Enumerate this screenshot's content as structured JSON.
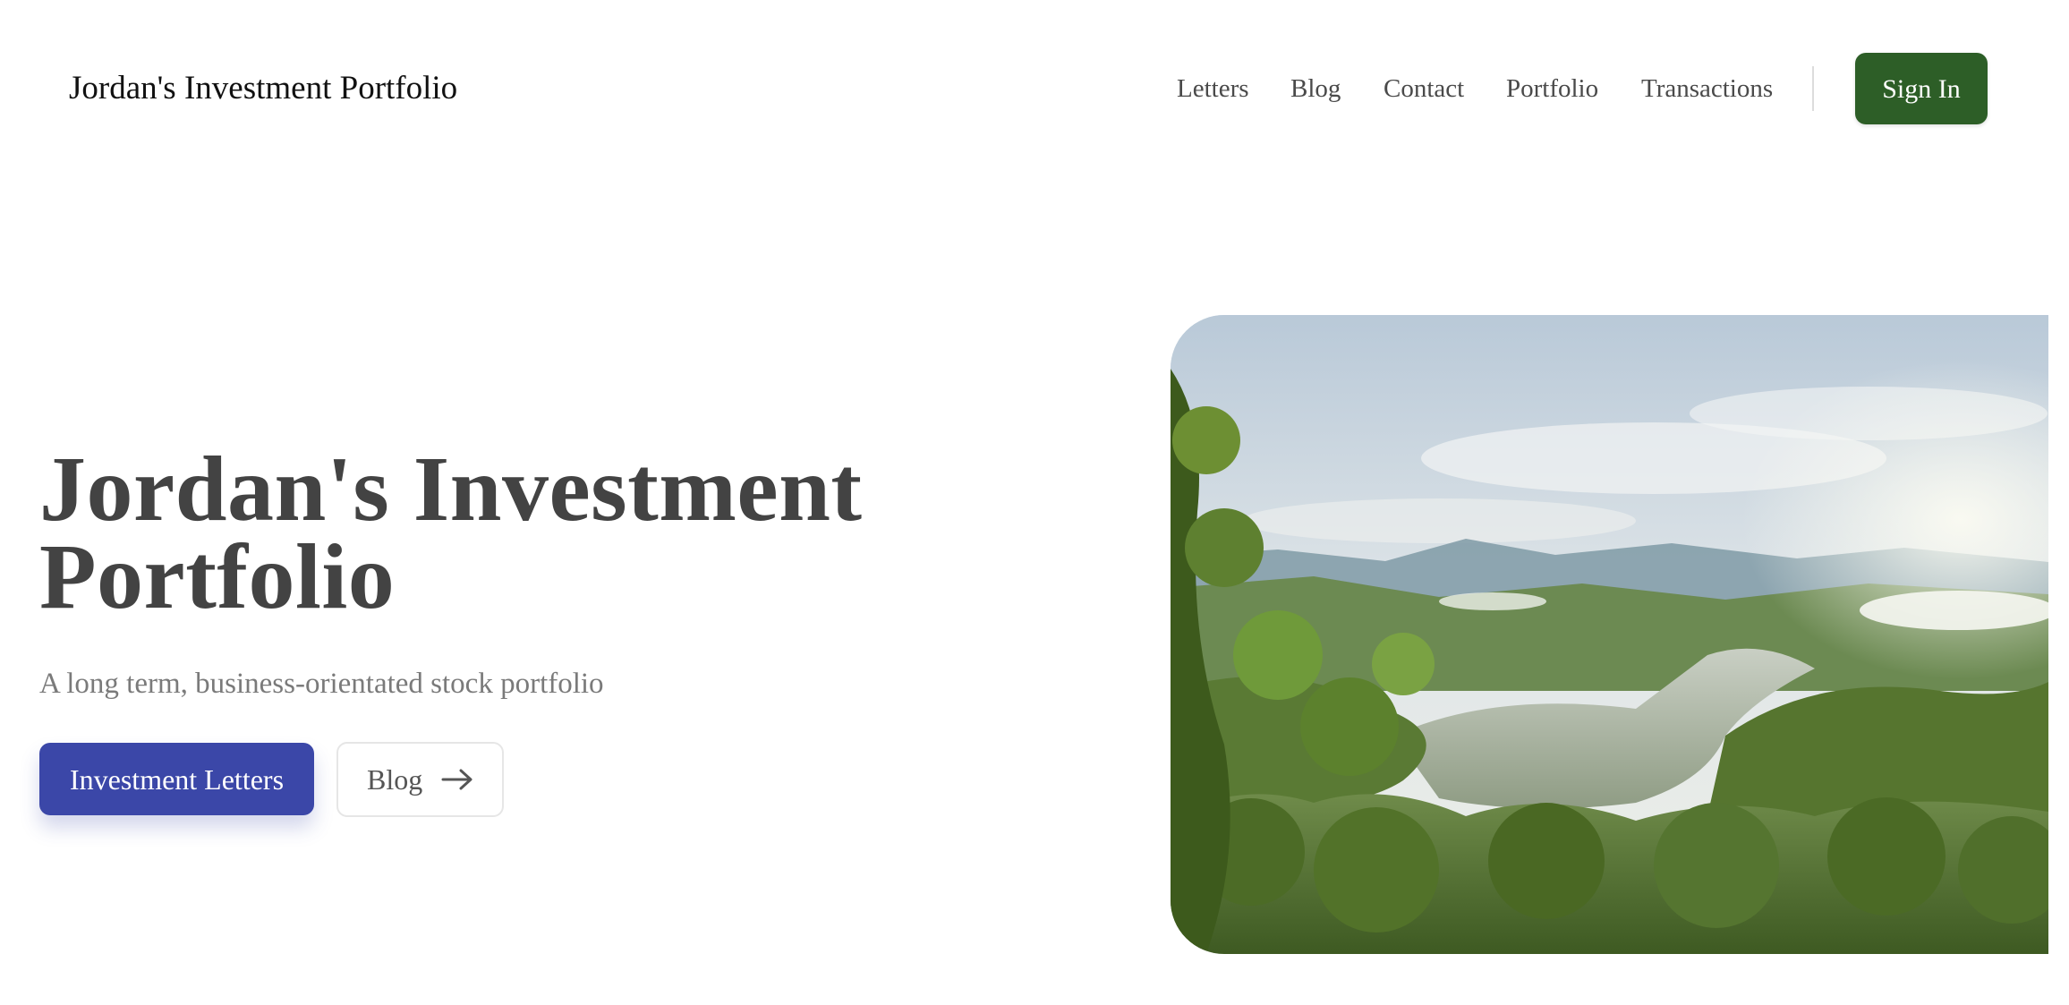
{
  "header": {
    "site_title": "Jordan's Investment Portfolio",
    "nav": [
      {
        "label": "Letters"
      },
      {
        "label": "Blog"
      },
      {
        "label": "Contact"
      },
      {
        "label": "Portfolio"
      },
      {
        "label": "Transactions"
      }
    ],
    "signin_label": "Sign In"
  },
  "hero": {
    "heading": "Jordan's Investment Portfolio",
    "subtitle": "A long term, business-orientated stock portfolio",
    "primary_button_label": "Investment Letters",
    "secondary_button_label": "Blog",
    "secondary_button_icon": "arrow-right-icon",
    "image_subject": ""
  },
  "colors": {
    "signin_bg": "#2d5e27",
    "primary_button_bg": "#3b47a8",
    "heading_text": "#434343",
    "subtitle_text": "#7a7a7a",
    "nav_text": "#4a4a4a"
  }
}
